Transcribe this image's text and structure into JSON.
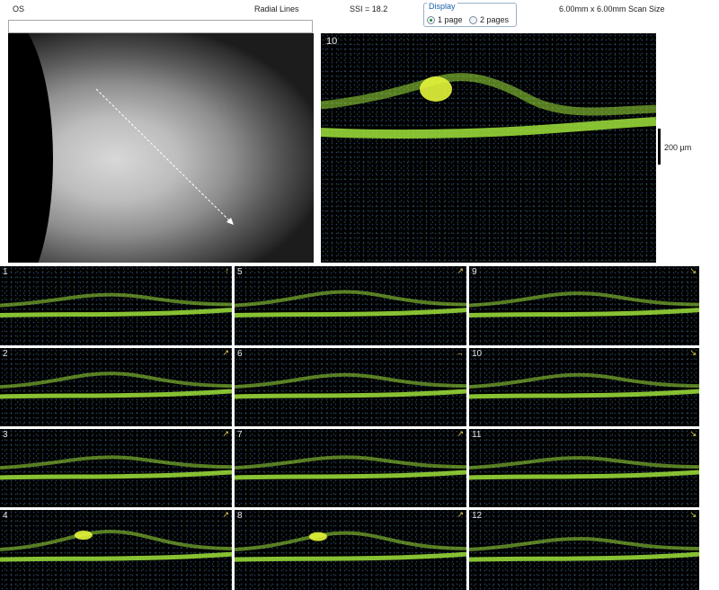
{
  "header": {
    "eye": "OS",
    "protocol": "Radial Lines",
    "ssi": "SSI = 18.2",
    "display": {
      "legend": "Display",
      "options": [
        {
          "label": "1 page",
          "selected": true
        },
        {
          "label": "2 pages",
          "selected": false
        }
      ]
    },
    "scan_size": "6.00mm x 6.00mm Scan Size"
  },
  "large_scan": {
    "number": "10"
  },
  "scale": {
    "label": "200 µm"
  },
  "scans": [
    {
      "number": "1",
      "arrow": "↑"
    },
    {
      "number": "5",
      "arrow": "↗"
    },
    {
      "number": "9",
      "arrow": "↘"
    },
    {
      "number": "2",
      "arrow": "↗"
    },
    {
      "number": "6",
      "arrow": "→"
    },
    {
      "number": "10",
      "arrow": "↘"
    },
    {
      "number": "3",
      "arrow": "↗"
    },
    {
      "number": "7",
      "arrow": "↗"
    },
    {
      "number": "11",
      "arrow": "↘"
    },
    {
      "number": "4",
      "arrow": "↗"
    },
    {
      "number": "8",
      "arrow": "↗"
    },
    {
      "number": "12",
      "arrow": "↘"
    }
  ],
  "colors": {
    "retina": "#9fe23a",
    "retina_bright": "#e4f53a",
    "noise": "#3a66b8"
  }
}
